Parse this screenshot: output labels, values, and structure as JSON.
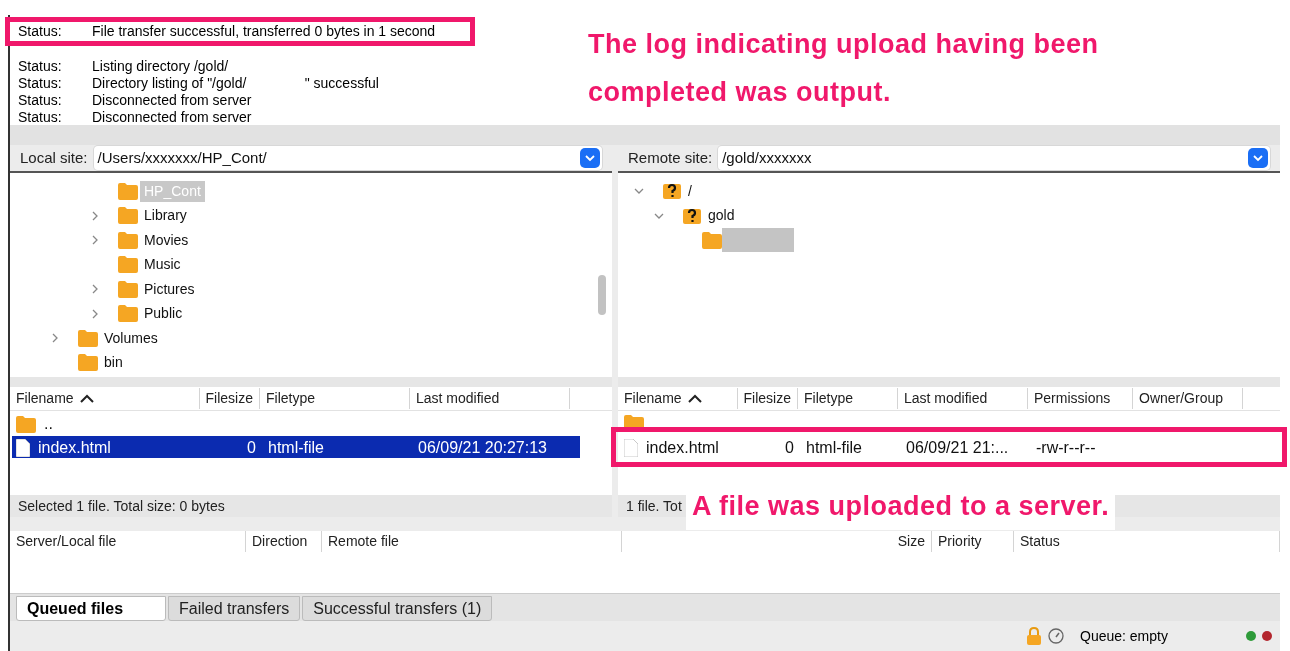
{
  "log": {
    "entries": [
      {
        "label": "Status:",
        "message": "File transfer successful, transferred 0 bytes in 1 second",
        "highlight": true
      },
      {
        "label": "Status:",
        "message": "Listing directory /gold/",
        "highlight": false
      },
      {
        "label": "Status:",
        "message": "Directory listing of \"/gold/               \" successful",
        "highlight": false
      },
      {
        "label": "Status:",
        "message": "Disconnected from server",
        "highlight": false
      },
      {
        "label": "Status:",
        "message": "Disconnected from server",
        "highlight": false
      }
    ]
  },
  "annotations": [
    {
      "text": "The log indicating upload having been completed was output."
    },
    {
      "text": "A file was uploaded to a server."
    }
  ],
  "local": {
    "label": "Local site:",
    "path": "/Users/xxxxxxx/HP_Cont/",
    "tree": [
      {
        "children": [
          {
            "name": "HP_Cont",
            "selected": true,
            "kind": "folder"
          },
          {
            "name": "Library",
            "selected": false,
            "expanded": false,
            "kind": "folder"
          },
          {
            "name": "Movies",
            "selected": false,
            "expanded": false,
            "kind": "folder"
          },
          {
            "name": "Music",
            "selected": false,
            "kind": "folder"
          },
          {
            "name": "Pictures",
            "selected": false,
            "expanded": false,
            "kind": "folder"
          },
          {
            "name": "Public",
            "selected": false,
            "expanded": false,
            "kind": "folder"
          }
        ]
      },
      {
        "name": "Volumes",
        "selected": false,
        "expanded": false,
        "kind": "folder"
      },
      {
        "name": "bin",
        "selected": false,
        "kind": "folder"
      }
    ],
    "columns": [
      "Filename",
      "Filesize",
      "Filetype",
      "Last modified"
    ],
    "rows": [
      {
        "kind": "folder",
        "cells": [
          ".."
        ],
        "selected": false,
        "highlight": false
      },
      {
        "kind": "file",
        "cells": [
          "index.html",
          "0",
          "html-file",
          "06/09/21 20:27:13"
        ],
        "selected": true,
        "highlight": false
      }
    ],
    "status": "Selected 1 file. Total size: 0 bytes"
  },
  "remote": {
    "label": "Remote site:",
    "path": "/gold/xxxxxxx",
    "tree": [
      {
        "name": "/",
        "selected": false,
        "expanded": true,
        "kind": "unknown",
        "children": [
          {
            "name": "gold",
            "selected": false,
            "expanded": true,
            "kind": "unknown",
            "children": [
              {
                "redacted": true,
                "selected": false,
                "kind": "folder"
              }
            ]
          }
        ]
      }
    ],
    "columns": [
      "Filename",
      "Filesize",
      "Filetype",
      "Last modified",
      "Permissions",
      "Owner/Group"
    ],
    "rows": [
      {
        "kind": "folder",
        "cells": [],
        "selected": false,
        "highlight": false
      },
      {
        "kind": "file",
        "cells": [
          "index.html",
          "0",
          "html-file",
          "06/09/21 21:...",
          "-rw-r--r--"
        ],
        "selected": false,
        "highlight": true
      }
    ],
    "status": "1 file. Tot"
  },
  "queue": {
    "columns": [
      "Server/Local file",
      "Direction",
      "Remote file",
      "Size",
      "Priority",
      "Status"
    ],
    "tabs": [
      {
        "label": "Queued files",
        "selected": true
      },
      {
        "label": "Failed transfers",
        "selected": false
      },
      {
        "label": "Successful transfers (1)",
        "selected": false
      }
    ]
  },
  "status_bar": {
    "queue": "Queue: empty",
    "lights": [
      {
        "color": "#2e9b3a"
      },
      {
        "color": "#b3262e"
      }
    ]
  }
}
